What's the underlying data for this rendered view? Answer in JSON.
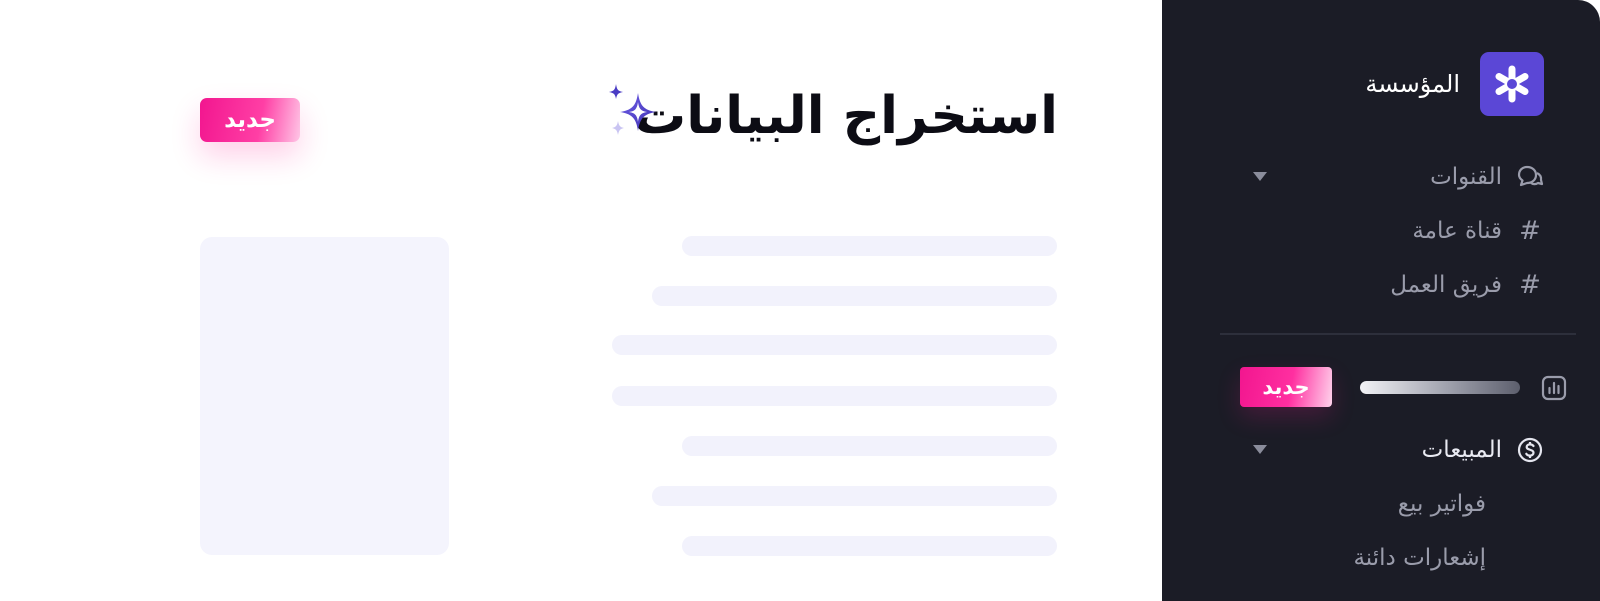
{
  "main": {
    "title": "استخراج البيانات",
    "badge": "جديد"
  },
  "sidebar": {
    "org_name": "المؤسسة",
    "channels": {
      "label": "القنوات",
      "items": [
        {
          "prefix": "#",
          "label": "قناة عامة"
        },
        {
          "prefix": "#",
          "label": "فريق العمل"
        }
      ]
    },
    "analytics_badge": "جديد",
    "sales": {
      "label": "المبيعات",
      "items": [
        {
          "label": "فواتير بيع"
        },
        {
          "label": "إشعارات دائنة"
        }
      ]
    }
  },
  "colors": {
    "sidebar_bg": "#1b1c26",
    "brand": "#5b47d6",
    "badge_pink": "#f2168f",
    "placeholder": "#f4f4fd"
  },
  "icons": [
    "asterisk-logo-icon",
    "chat-bubbles-icon",
    "hash-icon",
    "bar-chart-icon",
    "dollar-circle-icon",
    "sparkle-icon",
    "chevron-down-icon"
  ]
}
